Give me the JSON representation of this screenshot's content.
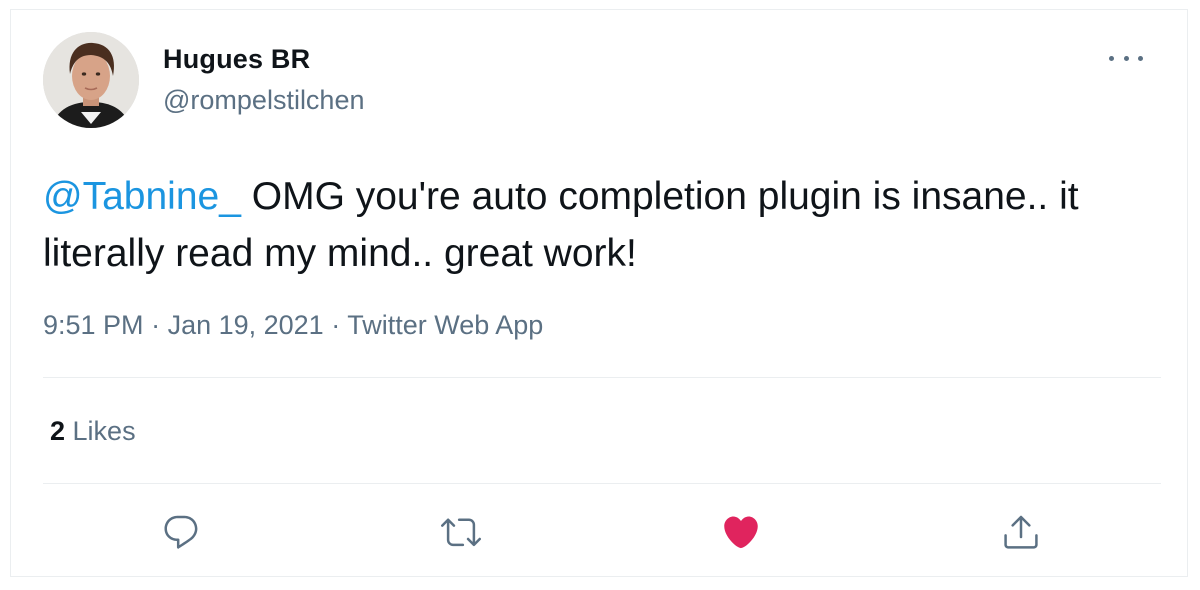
{
  "tweet": {
    "author": {
      "display_name": "Hugues BR",
      "handle": "@rompelstilchen"
    },
    "text": {
      "mention": "@Tabnine_",
      "body": " OMG you're auto completion plugin is insane.. it literally read my mind.. great work!"
    },
    "meta": {
      "time": "9:51 PM",
      "separator1": " · ",
      "date": "Jan 19, 2021",
      "separator2": " · ",
      "source": "Twitter Web App"
    },
    "stats": {
      "likes_count": "2",
      "likes_label": " Likes"
    },
    "icons": {
      "more": "more-icon",
      "reply": "reply-icon",
      "retweet": "retweet-icon",
      "like": "heart-icon",
      "share": "share-icon"
    },
    "colors": {
      "mention": "#1b95e0",
      "secondary_text": "#5b7083",
      "like_active": "#e0245e",
      "divider": "#ebeef0"
    }
  }
}
